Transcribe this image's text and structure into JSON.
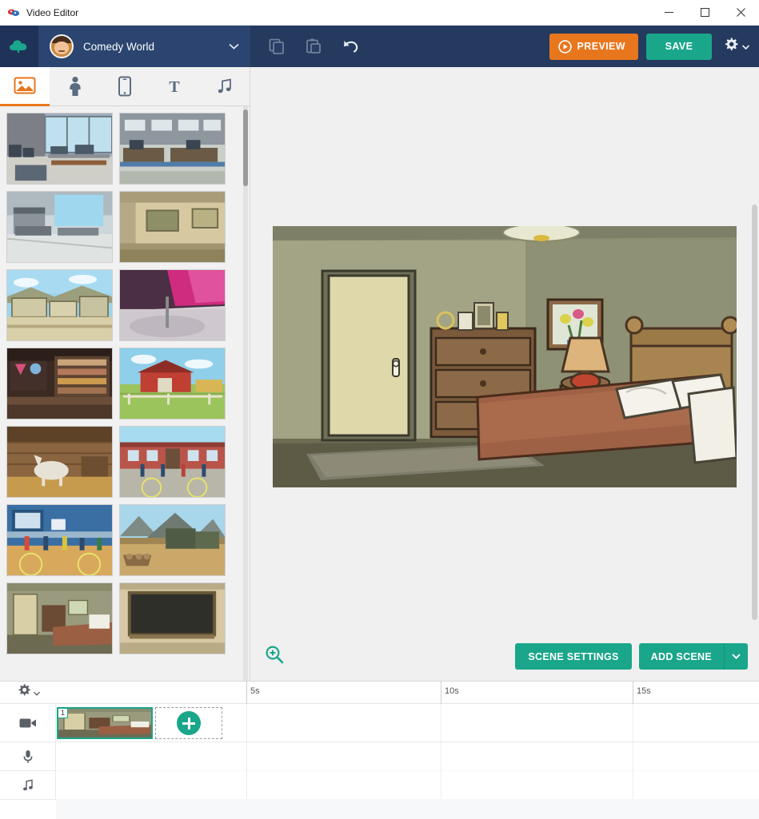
{
  "window": {
    "title": "Video Editor",
    "app_icon": "app-logo-icon",
    "minimize": "minimize-icon",
    "maximize": "maximize-icon",
    "close": "close-icon"
  },
  "toolbar": {
    "upload_icon": "cloud-upload-icon",
    "world_name": "Comedy World",
    "world_dropdown_icon": "chevron-down-icon",
    "copy_scene_icon": "copy-scene-icon",
    "paste_scene_icon": "paste-scene-icon",
    "undo_icon": "undo-arrow-icon",
    "preview_label": "PREVIEW",
    "preview_icon": "play-circle-icon",
    "save_label": "SAVE",
    "settings_icon": "gear-icon",
    "settings_caret_icon": "caret-down-icon",
    "accent_orange": "#e8761d",
    "accent_teal": "#1aa68a",
    "toolbar_blue": "#243a5e"
  },
  "left_panel": {
    "tabs": [
      {
        "name": "backgrounds",
        "icon": "image-icon",
        "active": true
      },
      {
        "name": "characters",
        "icon": "person-icon",
        "active": false
      },
      {
        "name": "props",
        "icon": "phone-prop-icon",
        "active": false
      },
      {
        "name": "text",
        "icon": "text-T-icon",
        "active": false
      },
      {
        "name": "audio",
        "icon": "music-note-icon",
        "active": false
      }
    ],
    "thumbnails": [
      {
        "name": "office-waiting-room",
        "label": ""
      },
      {
        "name": "office-cubicles",
        "label": ""
      },
      {
        "name": "security-checkpoint",
        "label": ""
      },
      {
        "name": "gallery-room",
        "label": ""
      },
      {
        "name": "desert-town",
        "label": ""
      },
      {
        "name": "pink-stage",
        "label": ""
      },
      {
        "name": "convenience-store",
        "label": ""
      },
      {
        "name": "red-barn-farm",
        "label": ""
      },
      {
        "name": "barn-interior-horse",
        "label": ""
      },
      {
        "name": "schoolyard-basketball",
        "label": ""
      },
      {
        "name": "gym-basketball-court",
        "label": ""
      },
      {
        "name": "mountain-firewood",
        "label": ""
      },
      {
        "name": "bedroom",
        "label": ""
      },
      {
        "name": "classroom-chalkboard",
        "label": ""
      }
    ],
    "scrollbar": "left-panel-scrollbar"
  },
  "canvas": {
    "scene_name": "bedroom-scene-preview",
    "zoom_icon": "zoom-in-icon",
    "scene_settings_label": "SCENE SETTINGS",
    "add_scene_label": "ADD SCENE",
    "add_scene_caret_icon": "chevron-down-icon",
    "scrollbar": "canvas-scrollbar"
  },
  "timeline": {
    "settings_icon": "gear-icon",
    "settings_caret_icon": "caret-down-icon",
    "ruler_ticks": [
      "5s",
      "10s",
      "15s"
    ],
    "tracks": [
      {
        "name": "video-track",
        "icon": "video-camera-icon"
      },
      {
        "name": "voice-track",
        "icon": "microphone-icon"
      },
      {
        "name": "music-track",
        "icon": "music-note-icon"
      }
    ],
    "scene_number": "1",
    "scene_clip_name": "bedroom-clip",
    "add_scene_placeholder_icon": "plus-circle-icon"
  }
}
